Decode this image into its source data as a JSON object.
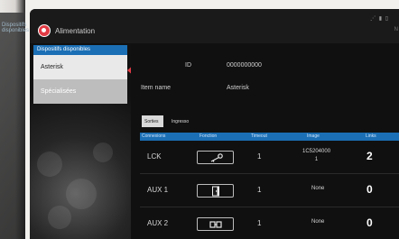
{
  "app": {
    "title": "Alimentation"
  },
  "status": {
    "icons": "⋰ ▮ ▯",
    "corner": "N"
  },
  "left_bg": {
    "title": "Dispositifs disponibles"
  },
  "menu": {
    "header": "Dispositifs disponibles",
    "items": [
      {
        "label": "Asterisk",
        "active": true
      },
      {
        "label": "Spécialisées",
        "active": false
      }
    ]
  },
  "details": {
    "id_label": "ID",
    "id_value": "0000000000",
    "item_name_label": "Item name",
    "item_name_value": "Asterisk"
  },
  "tabs": [
    {
      "label": "Sorties",
      "active": true
    },
    {
      "label": "Ingresso",
      "active": false
    }
  ],
  "table": {
    "headers": [
      "Connexions",
      "Fonction",
      "Timeout",
      "Image",
      "Links"
    ],
    "rows": [
      {
        "name": "LCK",
        "icon": "key-icon",
        "timeout": "1",
        "image": "1C5204000\n1",
        "links": "2"
      },
      {
        "name": "AUX 1",
        "icon": "door-icon",
        "timeout": "1",
        "image": "None",
        "links": "0"
      },
      {
        "name": "AUX 2",
        "icon": "double-door-icon",
        "timeout": "1",
        "image": "None",
        "links": "0"
      }
    ]
  },
  "colors": {
    "accent": "#1b6fb5",
    "brand": "#e23b45",
    "panel": "#101010"
  }
}
